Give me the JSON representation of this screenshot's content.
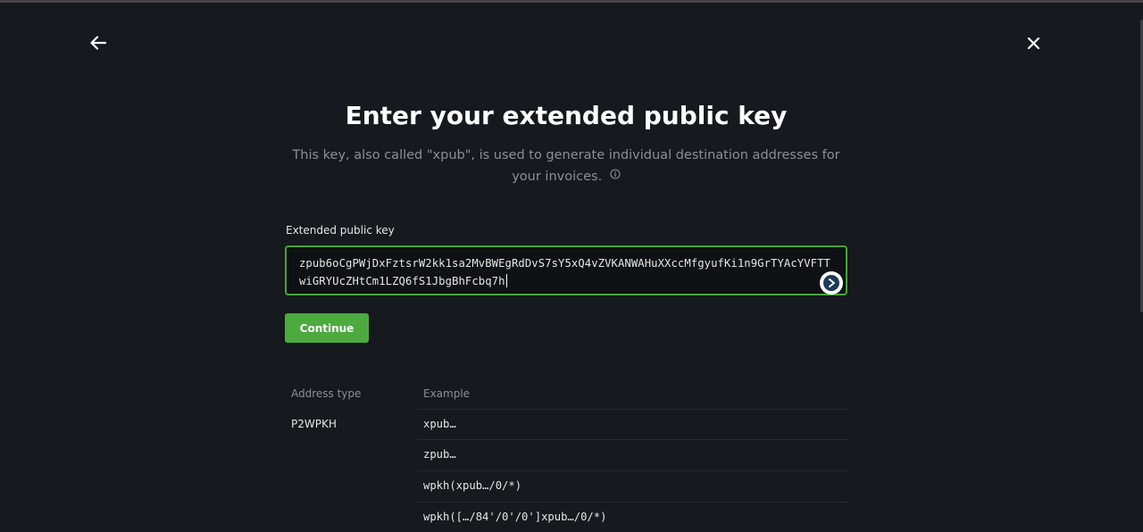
{
  "nav": {
    "back_icon": "arrow-left-icon",
    "close_icon": "close-icon"
  },
  "header": {
    "title": "Enter your extended public key",
    "subtitle": "This key, also called \"xpub\", is used to generate individual destination addresses for your invoices.",
    "info_icon": "info-circle-icon"
  },
  "form": {
    "label": "Extended public key",
    "value": "zpub6oCgPWjDxFztsrW2kk1sa2MvBWEgRdDvS7sY5xQ4vZVKANWAHuXXccMfgyufKi1n9GrTYAcYVFTTwiGRYUcZHtCm1LZQ6fS1JbgBhFcbq7h",
    "scan_icon": "scan-extension-icon",
    "continue_label": "Continue"
  },
  "table": {
    "headers": [
      "Address type",
      "Example"
    ],
    "address_type": "P2WPKH",
    "examples": [
      "xpub…",
      "zpub…",
      "wpkh(xpub…/0/*)",
      "wpkh([…/84'/0'/0']xpub…/0/*)"
    ]
  },
  "colors": {
    "background": "#16191d",
    "accent": "#4caa3f",
    "input_border": "#45a636",
    "muted_text": "#8b9097"
  }
}
